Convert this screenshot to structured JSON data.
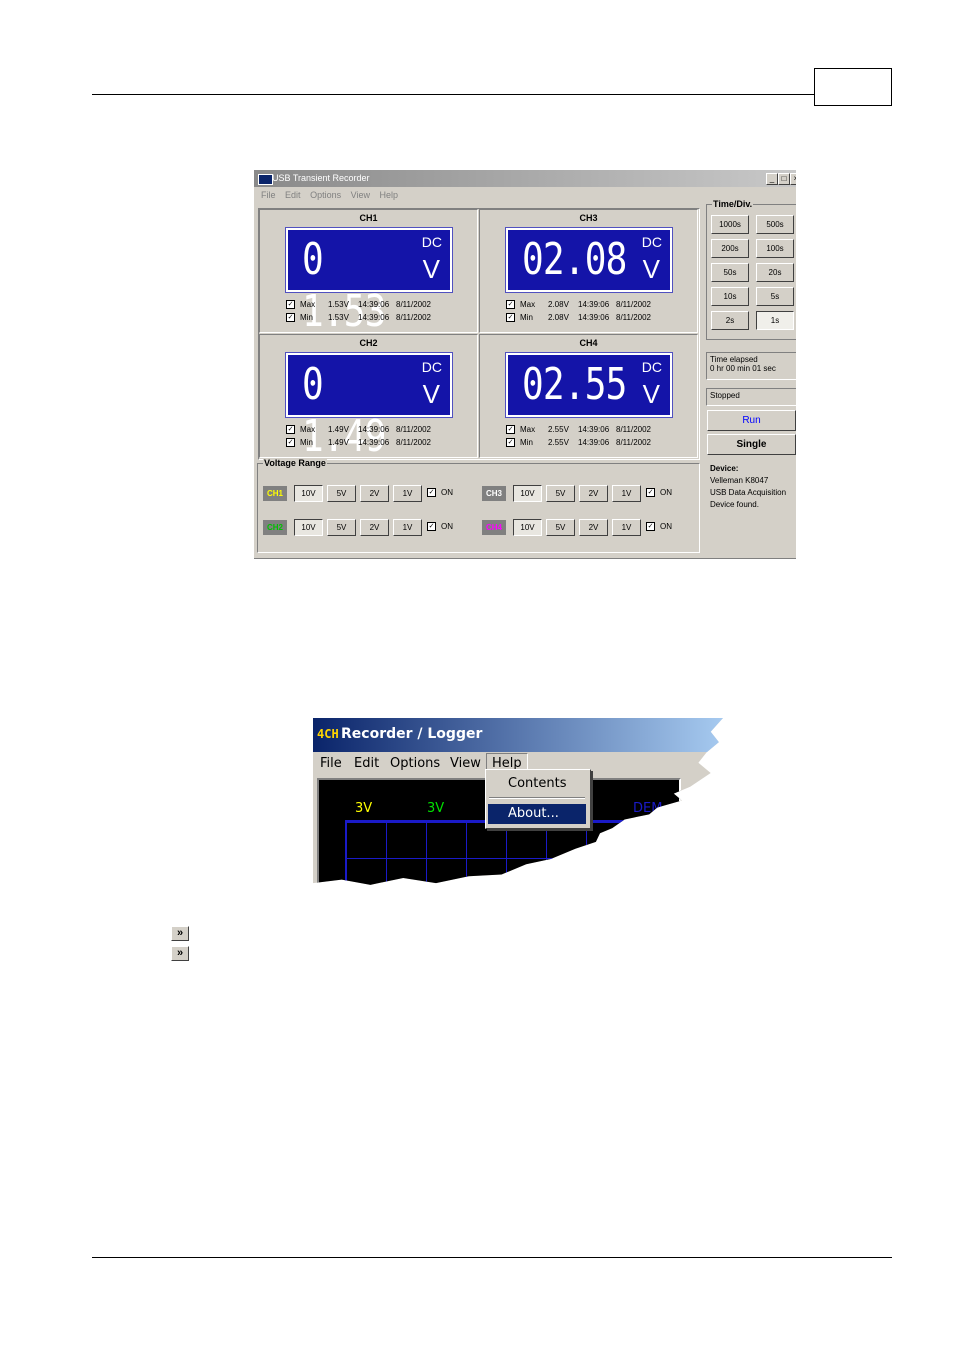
{
  "section_heading_1": "",
  "section_heading_2": "",
  "usb_window": {
    "title": "USB Transient Recorder",
    "menu": [
      "File",
      "Edit",
      "Options",
      "View",
      "Help"
    ],
    "channels": [
      {
        "name": "CH1",
        "reading": "0 1.53",
        "unit_dc": "DC",
        "unit_v": "V",
        "max": {
          "label": "Max",
          "value": "1.53V",
          "time": "14:39:06",
          "date": "8/11/2002"
        },
        "min": {
          "label": "Min",
          "value": "1.53V",
          "time": "14:39:06",
          "date": "8/11/2002"
        }
      },
      {
        "name": "CH3",
        "reading": "02.08",
        "unit_dc": "DC",
        "unit_v": "V",
        "max": {
          "label": "Max",
          "value": "2.08V",
          "time": "14:39:06",
          "date": "8/11/2002"
        },
        "min": {
          "label": "Min",
          "value": "2.08V",
          "time": "14:39:06",
          "date": "8/11/2002"
        }
      },
      {
        "name": "CH2",
        "reading": "0 1.49",
        "unit_dc": "DC",
        "unit_v": "V",
        "max": {
          "label": "Max",
          "value": "1.49V",
          "time": "14:39:06",
          "date": "8/11/2002"
        },
        "min": {
          "label": "Min",
          "value": "1.49V",
          "time": "14:39:06",
          "date": "8/11/2002"
        }
      },
      {
        "name": "CH4",
        "reading": "02.55",
        "unit_dc": "DC",
        "unit_v": "V",
        "max": {
          "label": "Max",
          "value": "2.55V",
          "time": "14:39:06",
          "date": "8/11/2002"
        },
        "min": {
          "label": "Min",
          "value": "2.55V",
          "time": "14:39:06",
          "date": "8/11/2002"
        }
      }
    ],
    "voltage_range": {
      "label": "Voltage Range",
      "ranges": [
        "10V",
        "5V",
        "2V",
        "1V"
      ],
      "on_label": "ON",
      "rows": [
        {
          "tag": "CH1",
          "tag_color": "#ffff00"
        },
        {
          "tag": "CH3",
          "tag_color": "#ffffff"
        },
        {
          "tag": "CH2",
          "tag_color": "#00c000"
        },
        {
          "tag": "CH4",
          "tag_color": "#ff00ff"
        }
      ]
    },
    "time_div": {
      "label": "Time/Div.",
      "buttons": [
        "1000s",
        "500s",
        "200s",
        "100s",
        "50s",
        "20s",
        "10s",
        "5s",
        "2s",
        "1s"
      ],
      "selected": "1s"
    },
    "time_elapsed_label": "Time elapsed",
    "time_elapsed_value": "0 hr  00 min  01 sec",
    "status": "Stopped",
    "run_label": "Run",
    "single_label": "Single",
    "device": {
      "label": "Device:",
      "lines": [
        "Velleman  K8047",
        "USB Data Acquisition",
        "Device found."
      ]
    },
    "colors": {
      "lcd_bg": "#1414a8",
      "run_text": "#0000ff"
    }
  },
  "logger_window": {
    "logo": "4CH",
    "title": "Recorder / Logger",
    "menu": [
      "File",
      "Edit",
      "Options",
      "View",
      "Help"
    ],
    "active_menu": "Help",
    "dropdown": [
      "Contents",
      "About..."
    ],
    "highlighted_item": "About...",
    "scope_labels": [
      {
        "text": "3V",
        "color": "#ffff00"
      },
      {
        "text": "3V",
        "color": "#00e000"
      },
      {
        "text": "DEM",
        "color": "#1a1ac8"
      }
    ]
  },
  "nav_buttons": [
    "»",
    "»"
  ]
}
